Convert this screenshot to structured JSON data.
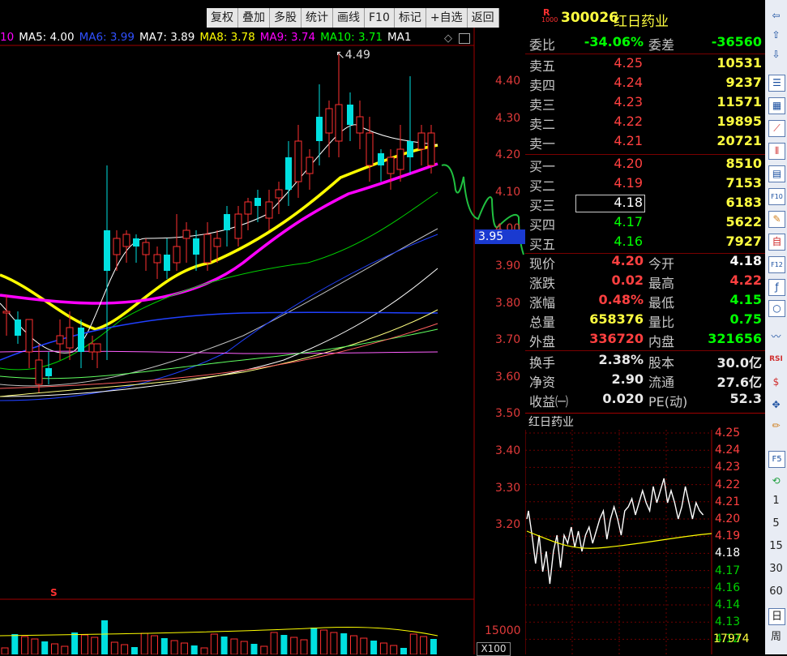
{
  "toolbar": {
    "buttons": [
      "复权",
      "叠加",
      "多股",
      "统计",
      "画线",
      "F10",
      "标记",
      "+自选",
      "返回"
    ]
  },
  "ma_legend": [
    {
      "label": "10",
      "color": "#ff00ff"
    },
    {
      "label": "MA5: 4.00",
      "color": "#ffffff"
    },
    {
      "label": "MA6: 3.99",
      "color": "#3050ff"
    },
    {
      "label": "MA7: 3.89",
      "color": "#ffffff"
    },
    {
      "label": "MA8: 3.78",
      "color": "#ffff00"
    },
    {
      "label": "MA9: 3.74",
      "color": "#ff00ff"
    },
    {
      "label": "MA10: 3.71",
      "color": "#00ff00"
    },
    {
      "label": "MA1",
      "color": "#ffffff"
    }
  ],
  "kline": {
    "high_label": "4.49",
    "y_ticks": [
      "4.40",
      "4.30",
      "4.20",
      "4.10",
      "4.00",
      "3.90",
      "3.80",
      "3.70",
      "3.60",
      "3.50",
      "3.40",
      "3.30",
      "3.20"
    ],
    "cursor_price": "3.95",
    "volume_tick": "15000",
    "volume_unit": "X100",
    "marker": "S"
  },
  "quote": {
    "code": "300026",
    "name": "红日药业",
    "badge_top": "R",
    "badge_bottom": "1000",
    "weibi_label": "委比",
    "weibi": "-34.06%",
    "weicha_label": "委差",
    "weicha": "-36560",
    "asks": [
      {
        "label": "卖五",
        "price": "4.25",
        "vol": "10531"
      },
      {
        "label": "卖四",
        "price": "4.24",
        "vol": "9237"
      },
      {
        "label": "卖三",
        "price": "4.23",
        "vol": "11571"
      },
      {
        "label": "卖二",
        "price": "4.22",
        "vol": "19895"
      },
      {
        "label": "卖一",
        "price": "4.21",
        "vol": "20721"
      }
    ],
    "bids": [
      {
        "label": "买一",
        "price": "4.20",
        "vol": "8510"
      },
      {
        "label": "买二",
        "price": "4.19",
        "vol": "7153"
      },
      {
        "label": "买三",
        "price": "4.18",
        "vol": "6183"
      },
      {
        "label": "买四",
        "price": "4.17",
        "vol": "5622"
      },
      {
        "label": "买五",
        "price": "4.16",
        "vol": "7927"
      }
    ],
    "stats": [
      {
        "l1": "现价",
        "v1": "4.20",
        "c1": "#ff4040",
        "l2": "今开",
        "v2": "4.18",
        "c2": "#ffffff"
      },
      {
        "l1": "涨跌",
        "v1": "0.02",
        "c1": "#ff4040",
        "l2": "最高",
        "v2": "4.22",
        "c2": "#ff4040"
      },
      {
        "l1": "涨幅",
        "v1": "0.48%",
        "c1": "#ff4040",
        "l2": "最低",
        "v2": "4.15",
        "c2": "#00ff00"
      },
      {
        "l1": "总量",
        "v1": "658376",
        "c1": "#ffff40",
        "l2": "量比",
        "v2": "0.75",
        "c2": "#00ff00"
      },
      {
        "l1": "外盘",
        "v1": "336720",
        "c1": "#ff4040",
        "l2": "内盘",
        "v2": "321656",
        "c2": "#00ff00"
      }
    ],
    "fund": [
      {
        "l1": "换手",
        "v1": "2.38%",
        "l2": "股本",
        "v2": "30.0亿"
      },
      {
        "l1": "净资",
        "v1": "2.90",
        "l2": "流通",
        "v2": "27.6亿"
      },
      {
        "l1": "收益㈠",
        "v1": "0.020",
        "l2": "PE(动)",
        "v2": "52.3"
      }
    ]
  },
  "mini": {
    "title": "红日药业",
    "ticks": [
      "4.25",
      "4.24",
      "4.23",
      "4.22",
      "4.21",
      "4.20",
      "4.19",
      "4.18",
      "4.17",
      "4.16",
      "4.14",
      "4.13",
      "4.12"
    ],
    "volume": "17974"
  },
  "side": {
    "numbers": [
      "1",
      "5",
      "15",
      "30",
      "60"
    ],
    "day": "日",
    "week": "周",
    "f5": "F5",
    "rsi": "RSI"
  }
}
